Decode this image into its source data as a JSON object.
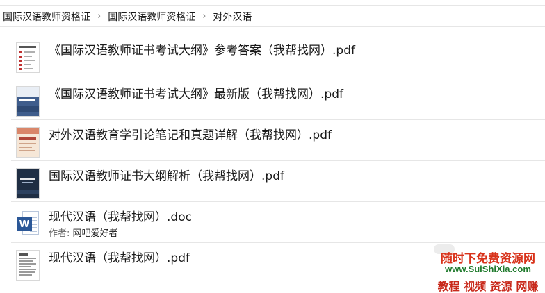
{
  "breadcrumb": {
    "items": [
      "国际汉语教师资格证",
      "国际汉语教师资格证",
      "对外汉语"
    ],
    "separator": "›"
  },
  "files": [
    {
      "name": "《国际汉语教师证书考试大纲》参考答案（我帮找网）.pdf",
      "thumbnail": "answer-sheet-thumbnail"
    },
    {
      "name": "《国际汉语教师证书考试大纲》最新版（我帮找网）.pdf",
      "thumbnail": "blue-book-cover-thumbnail"
    },
    {
      "name": "对外汉语教育学引论笔记和真题详解（我帮找网）.pdf",
      "thumbnail": "orange-book-cover-thumbnail"
    },
    {
      "name": "国际汉语教师证书大纲解析（我帮找网）.pdf",
      "thumbnail": "dark-book-cover-thumbnail"
    },
    {
      "name": "现代汉语（我帮找网）.doc",
      "author_label": "作者:",
      "author": "网吧爱好者",
      "thumbnail": "word-document-icon"
    },
    {
      "name": "现代汉语（我帮找网）.pdf",
      "thumbnail": "text-page-thumbnail"
    }
  ],
  "watermark": {
    "line1": "随时下免费资源网",
    "line2": "www.SuiShiXia.com",
    "line3": "教程 视频 资源 网赚"
  },
  "icons": {
    "word_letter": "W"
  },
  "colors": {
    "watermark_red": "#d8321a",
    "watermark_green": "#1f7a2c",
    "word_blue": "#2b5797"
  }
}
